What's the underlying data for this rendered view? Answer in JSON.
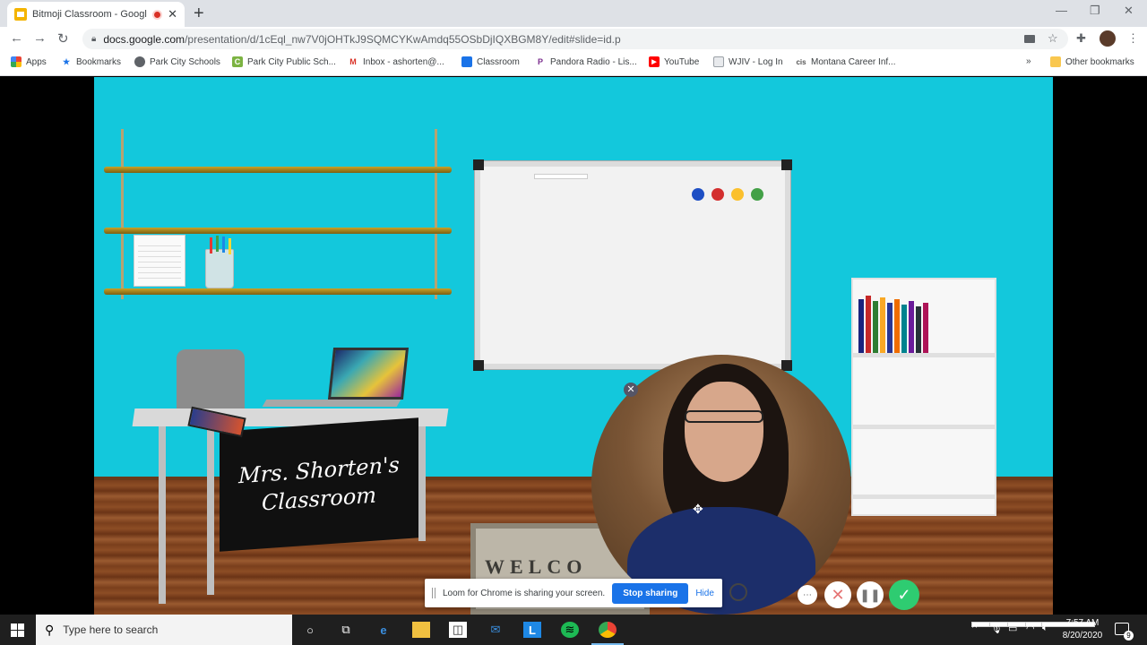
{
  "browser": {
    "tab_title": "Bitmoji Classroom - Google",
    "url_host": "docs.google.com",
    "url_path": "/presentation/d/1cEql_nw7V0jOHTkJ9SQMCYKwAmdq55OSbDjIQXBGM8Y/edit#slide=id.p",
    "bookmarks": [
      {
        "label": "Apps",
        "icon": "apps-grid-icon",
        "color": "#ea4335"
      },
      {
        "label": "Bookmarks",
        "icon": "star-icon",
        "color": "#1a73e8"
      },
      {
        "label": "Park City Schools",
        "icon": "globe-icon",
        "color": "#5f6368"
      },
      {
        "label": "Park City Public Sch...",
        "icon": "c-logo-icon",
        "color": "#7cb342"
      },
      {
        "label": "Inbox - ashorten@...",
        "icon": "gmail-icon",
        "color": "#d93025"
      },
      {
        "label": "Classroom",
        "icon": "classroom-icon",
        "color": "#1a73e8"
      },
      {
        "label": "Pandora Radio - Lis...",
        "icon": "pandora-icon",
        "color": "#7b2e8e"
      },
      {
        "label": "YouTube",
        "icon": "youtube-icon",
        "color": "#ff0000"
      },
      {
        "label": "WJIV - Log In",
        "icon": "doc-icon",
        "color": "#9aa0a6"
      },
      {
        "label": "Montana Career Inf...",
        "icon": "mci-icon",
        "color": "#555555"
      }
    ],
    "other_bookmarks": "Other bookmarks"
  },
  "slide": {
    "sign_line1": "Mrs. Shorten's",
    "sign_line2": "Classroom",
    "rug_text": "WELCO",
    "wall_color": "#13c8dc"
  },
  "loom": {
    "share_message": "Loom for Chrome is sharing your screen.",
    "stop_label": "Stop sharing",
    "hide_label": "Hide"
  },
  "taskbar": {
    "search_placeholder": "Type here to search",
    "time": "7:57 AM",
    "date": "8/20/2020",
    "notifications": "9"
  }
}
